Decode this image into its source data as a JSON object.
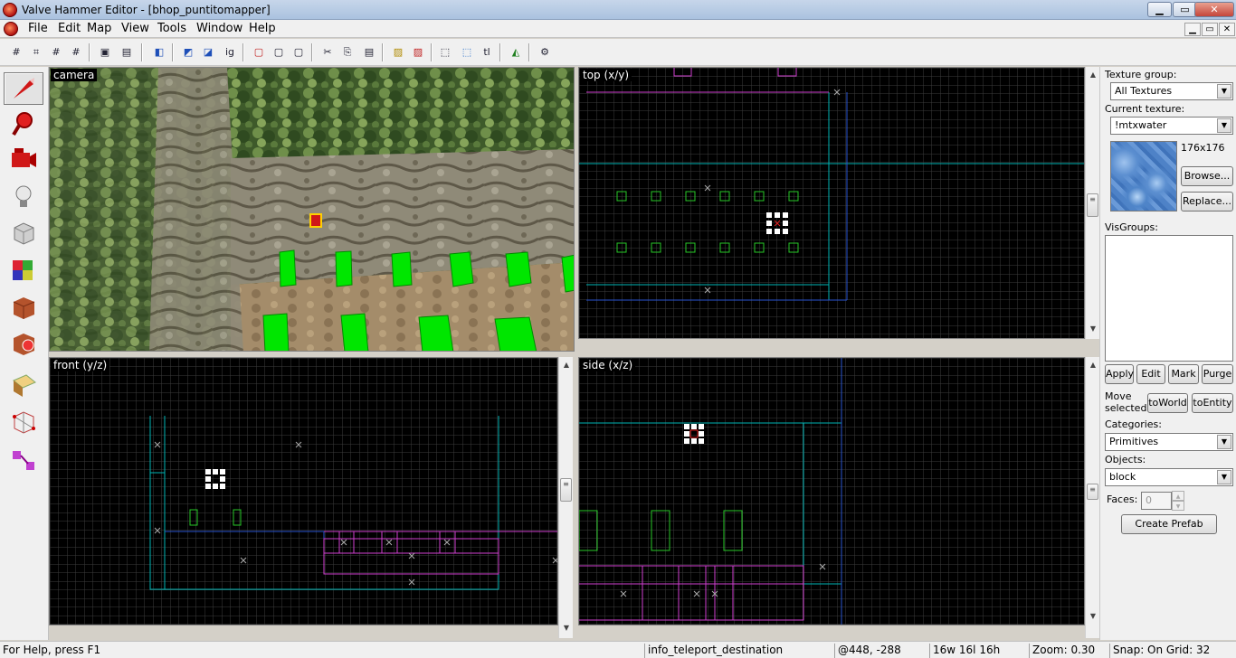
{
  "window": {
    "title": "Valve Hammer Editor - [bhop_puntitomapper]",
    "min": "▁",
    "max": "▭",
    "close": "✕"
  },
  "menu": {
    "items": [
      "File",
      "Edit",
      "Map",
      "View",
      "Tools",
      "Window",
      "Help"
    ]
  },
  "viewports": {
    "camera": {
      "label": "camera"
    },
    "top": {
      "label": "top (x/y)"
    },
    "front": {
      "label": "front (y/z)"
    },
    "side": {
      "label": "side (x/z)"
    }
  },
  "toolbar_icons": [
    "grid-icon",
    "grid-toggle-icon",
    "grid-smaller-icon",
    "grid-larger-icon",
    "group-icon",
    "ungroup-icon",
    "carve-icon",
    "toggle-group-ignore-icon",
    "hide-icon",
    "ignore-group-icon",
    "undo-icon",
    "redo-icon",
    "cut-icon",
    "copy-icon",
    "paste-icon",
    "texture-lock-icon",
    "texture-scale-icon",
    "selection-box-icon",
    "select-icon",
    "tie-to-entity-icon",
    "vertex-icon",
    "run-map-icon"
  ],
  "tools": [
    "selection-tool",
    "magnify-tool",
    "camera-tool",
    "entity-tool",
    "block-tool",
    "texture-tool",
    "apply-current-texture-tool",
    "decal-tool",
    "overlay-tool",
    "clipping-tool",
    "vertex-manipulation-tool",
    "path-tool"
  ],
  "texture": {
    "group_label": "Texture group:",
    "group_value": "All Textures",
    "current_label": "Current texture:",
    "current_value": "!mtxwater",
    "size": "176x176",
    "browse": "Browse...",
    "replace": "Replace..."
  },
  "visgroups": {
    "label": "VisGroups:",
    "apply": "Apply",
    "edit": "Edit",
    "mark": "Mark",
    "purge": "Purge"
  },
  "move": {
    "label_line1": "Move",
    "label_line2": "selected:",
    "to_world": "toWorld",
    "to_entity": "toEntity"
  },
  "categories": {
    "label": "Categories:",
    "value": "Primitives"
  },
  "objects": {
    "label": "Objects:",
    "value": "block"
  },
  "faces": {
    "label": "Faces:",
    "value": "0"
  },
  "create_prefab": "Create Prefab",
  "status": {
    "help": "For Help, press F1",
    "entity": "info_teleport_destination",
    "coords": "@448, -288",
    "size": "16w 16l 16h",
    "zoom": "Zoom: 0.30",
    "snap": "Snap: On Grid: 32"
  },
  "colors": {
    "grid": "#3a3a3a",
    "grid_major": "#4f4f4f",
    "cyan": "#00c8c8",
    "magenta": "#d040d0",
    "green": "#28c828",
    "blue": "#2a55d0"
  }
}
